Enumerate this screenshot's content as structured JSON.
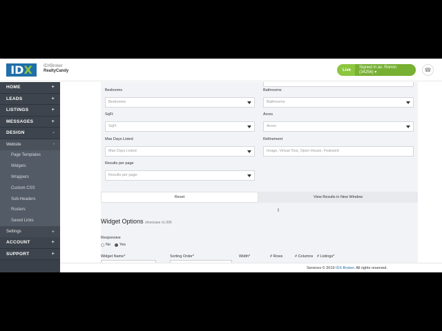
{
  "header": {
    "logo_main": "ID",
    "logo_x": "X",
    "brand_line1": "IDXBroker",
    "brand_line2": "RealtyCandy",
    "live": "Live",
    "signed_in": "Signed in as: Ronon (34256) ▾",
    "bell_icon": "bell-icon"
  },
  "sidebar": {
    "items": [
      {
        "label": "HOME",
        "pm": "+"
      },
      {
        "label": "LEADS",
        "pm": "+"
      },
      {
        "label": "LISTINGS",
        "pm": "+"
      },
      {
        "label": "MESSAGES",
        "pm": "+"
      },
      {
        "label": "DESIGN",
        "pm": "-"
      }
    ],
    "website": {
      "label": "Website",
      "pm": "-"
    },
    "website_children": [
      "Page Templates",
      "Widgets",
      "Wrappers",
      "Custom CSS",
      "Sub-Headers",
      "Rosters",
      "Saved Links"
    ],
    "settings": {
      "label": "Settings",
      "pm": "+"
    },
    "account": {
      "label": "ACCOUNT",
      "pm": "+"
    },
    "support": {
      "label": "SUPPORT",
      "pm": "+"
    }
  },
  "form": {
    "bedrooms_label": "Bedrooms",
    "bedrooms_placeholder": "Bedrooms",
    "bathrooms_label": "Bathrooms",
    "bathrooms_placeholder": "Bathrooms",
    "sqft_label": "SqFt",
    "sqft_placeholder": "SqFt",
    "acres_label": "Acres",
    "acres_placeholder": "Acres",
    "maxdays_label": "Max Days Listed",
    "maxdays_placeholder": "Max Days Listed",
    "refinement_label": "Refinement",
    "refinement_placeholder": "Image, Virtual Tour, Open House, Featured",
    "results_label": "Results per page",
    "results_placeholder": "Results per page",
    "reset": "Reset",
    "view_results": "View Results in New Window"
  },
  "widget_options": {
    "title": "Widget Options",
    "showcase": "showcase v1.006",
    "responsive_label": "Responsive",
    "no": "No",
    "yes": "Yes",
    "columns": [
      "Widget Name*",
      "Sorting Order*",
      "Width*",
      "# Rows",
      "# Columns",
      "# Listings*"
    ]
  },
  "footer": {
    "prefix": "Services © 2019 ",
    "link": "IDX Broker",
    "suffix": ". All rights reserved."
  }
}
